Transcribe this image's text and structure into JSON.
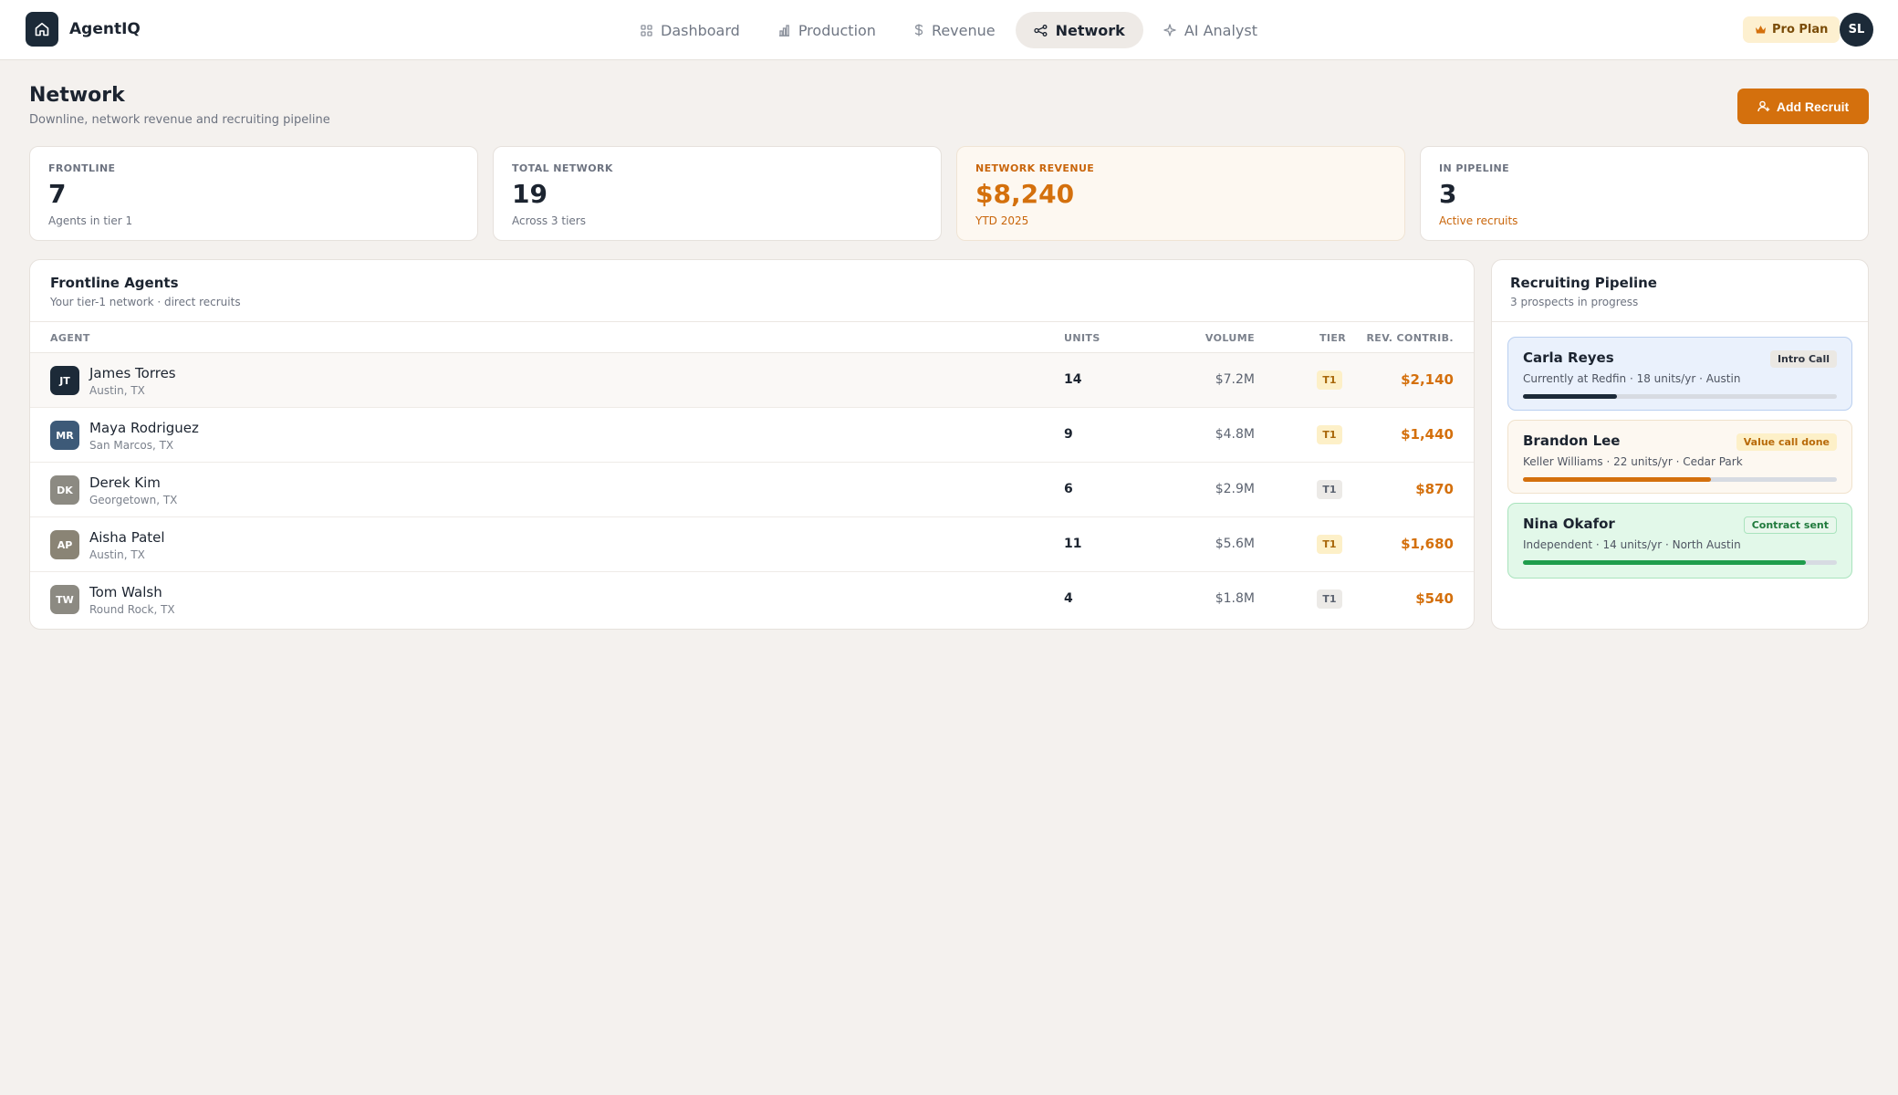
{
  "app": {
    "name": "AgentIQ",
    "logo_icon": "home-icon"
  },
  "nav": {
    "items": [
      {
        "label": "Dashboard",
        "icon": "grid-icon"
      },
      {
        "label": "Production",
        "icon": "bar-chart-icon"
      },
      {
        "label": "Revenue",
        "icon": "dollar-icon"
      },
      {
        "label": "Network",
        "icon": "network-icon",
        "active": true
      },
      {
        "label": "AI Analyst",
        "icon": "sparkle-icon"
      }
    ]
  },
  "plan": {
    "label": "Pro Plan",
    "icon": "crown-icon"
  },
  "user": {
    "initials": "SL"
  },
  "header": {
    "title": "Network",
    "subtitle": "Downline, network revenue and recruiting pipeline",
    "add_button": "Add Recruit"
  },
  "stats": [
    {
      "label": "FRONTLINE",
      "value": "7",
      "sub": "Agents in tier 1"
    },
    {
      "label": "TOTAL NETWORK",
      "value": "19",
      "sub": "Across 3 tiers"
    },
    {
      "label": "NETWORK REVENUE",
      "value": "$8,240",
      "sub": "YTD 2025"
    },
    {
      "label": "IN PIPELINE",
      "value": "3",
      "sub": "Active recruits"
    }
  ],
  "frontline": {
    "title": "Frontline Agents",
    "subtitle": "Your tier-1 network · direct recruits",
    "columns": {
      "agent": "AGENT",
      "units": "UNITS",
      "volume": "VOLUME",
      "tier": "TIER",
      "rev": "REV. CONTRIB."
    },
    "rows": [
      {
        "initials": "JT",
        "name": "James Torres",
        "location": "Austin, TX",
        "units": "14",
        "volume": "$7.2M",
        "tier": "T1",
        "rev": "$2,140",
        "avatar_color": "#1c2a38",
        "tier_style": "gold"
      },
      {
        "initials": "MR",
        "name": "Maya Rodriguez",
        "location": "San Marcos, TX",
        "units": "9",
        "volume": "$4.8M",
        "tier": "T1",
        "rev": "$1,440",
        "avatar_color": "#3d5a78",
        "tier_style": "gold"
      },
      {
        "initials": "DK",
        "name": "Derek Kim",
        "location": "Georgetown, TX",
        "units": "6",
        "volume": "$2.9M",
        "tier": "T1",
        "rev": "$870",
        "avatar_color": "#8c8a82",
        "tier_style": "gray"
      },
      {
        "initials": "AP",
        "name": "Aisha Patel",
        "location": "Austin, TX",
        "units": "11",
        "volume": "$5.6M",
        "tier": "T1",
        "rev": "$1,680",
        "avatar_color": "#8a8475",
        "tier_style": "gold"
      },
      {
        "initials": "TW",
        "name": "Tom Walsh",
        "location": "Round Rock, TX",
        "units": "4",
        "volume": "$1.8M",
        "tier": "T1",
        "rev": "$540",
        "avatar_color": "#8c8a82",
        "tier_style": "gray"
      }
    ]
  },
  "pipeline": {
    "title": "Recruiting Pipeline",
    "subtitle": "3 prospects in progress",
    "items": [
      {
        "name": "Carla Reyes",
        "meta": "Currently at Redfin · 18 units/yr · Austin",
        "status": "Intro Call",
        "progress": 0.3,
        "bg": "#eaf1fc",
        "border": "#b9cff0",
        "bar": "#1c2a38",
        "badge_bg": "#ebe8e3",
        "badge_fg": "#2e3440"
      },
      {
        "name": "Brandon Lee",
        "meta": "Keller Williams · 22 units/yr · Cedar Park",
        "status": "Value call done",
        "progress": 0.6,
        "bg": "#fdf8f1",
        "border": "#f0e2cc",
        "bar": "#d4700d",
        "badge_bg": "#fdf0c8",
        "badge_fg": "#b86a08"
      },
      {
        "name": "Nina Okafor",
        "meta": "Independent · 14 units/yr · North Austin",
        "status": "Contract sent",
        "progress": 0.9,
        "bg": "#e2f8e9",
        "border": "#a9e3bd",
        "bar": "#1f9d4c",
        "badge_bg": "#e8f7ec",
        "badge_fg": "#1f7a3c"
      }
    ]
  }
}
